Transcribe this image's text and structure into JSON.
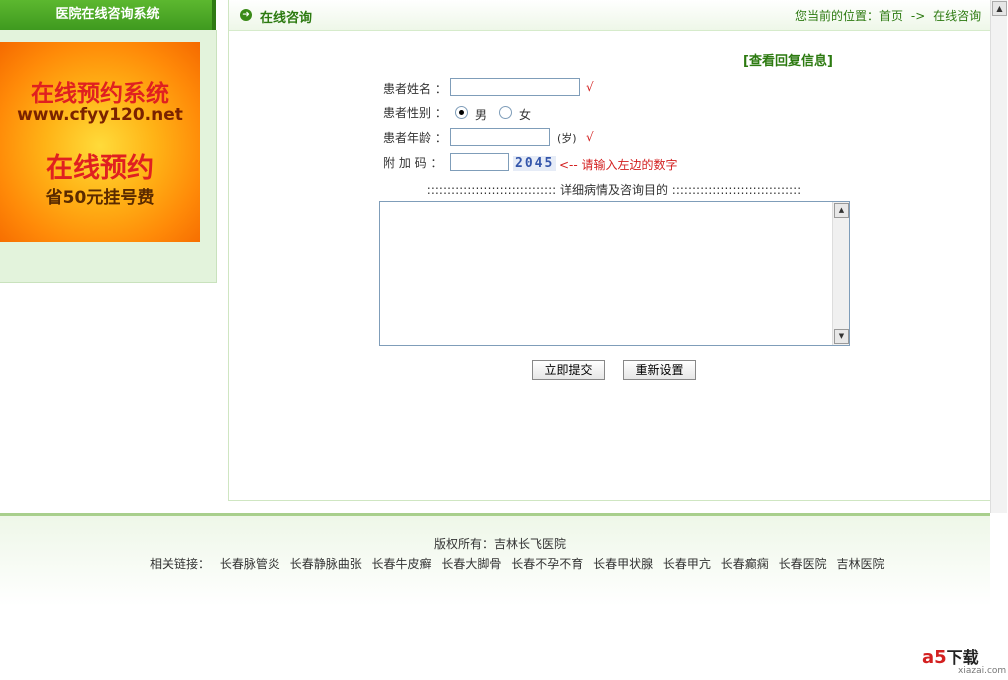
{
  "sidebar": {
    "title": "医院在线咨询系统",
    "banner": {
      "line1": "在线预约系统",
      "line2": "www.cfyy120.net",
      "line3": "在线预约",
      "line4": "省50元挂号费"
    }
  },
  "header": {
    "title": "在线咨询",
    "breadcrumb_prefix": "您当前的位置：",
    "breadcrumb_home": "首页",
    "breadcrumb_sep": "->",
    "breadcrumb_current": "在线咨询"
  },
  "form": {
    "view_replies": "[查看回复信息]",
    "name_label": "患者姓名",
    "gender_label": "患者性别",
    "gender_male": "男",
    "gender_female": "女",
    "gender_selected": "男",
    "age_label": "患者年龄",
    "age_unit": "(岁)",
    "code_label": "附 加 码",
    "captcha": "2045",
    "code_hint": "<-- 请输入左边的数字",
    "required_mark": "√",
    "colon": "：",
    "details_divider": "::::::::::::::::::::::::::::::::  详细病情及咨询目的  ::::::::::::::::::::::::::::::::",
    "submit": "立即提交",
    "reset": "重新设置"
  },
  "footer": {
    "copyright": "版权所有：吉林长飞医院",
    "links_label": "相关链接：",
    "links": [
      "长春脉管炎",
      "长春静脉曲张",
      "长春牛皮癣",
      "长春大脚骨",
      "长春不孕不育",
      "长春甲状腺",
      "长春甲亢",
      "长春癫痫",
      "长春医院",
      "吉林医院"
    ]
  },
  "watermark": {
    "brand": "a5",
    "text": "下载",
    "sub": "xiazai.com"
  },
  "colors": {
    "green": "#2c7a10",
    "red": "#d32020",
    "header_green": "#4aa824"
  }
}
